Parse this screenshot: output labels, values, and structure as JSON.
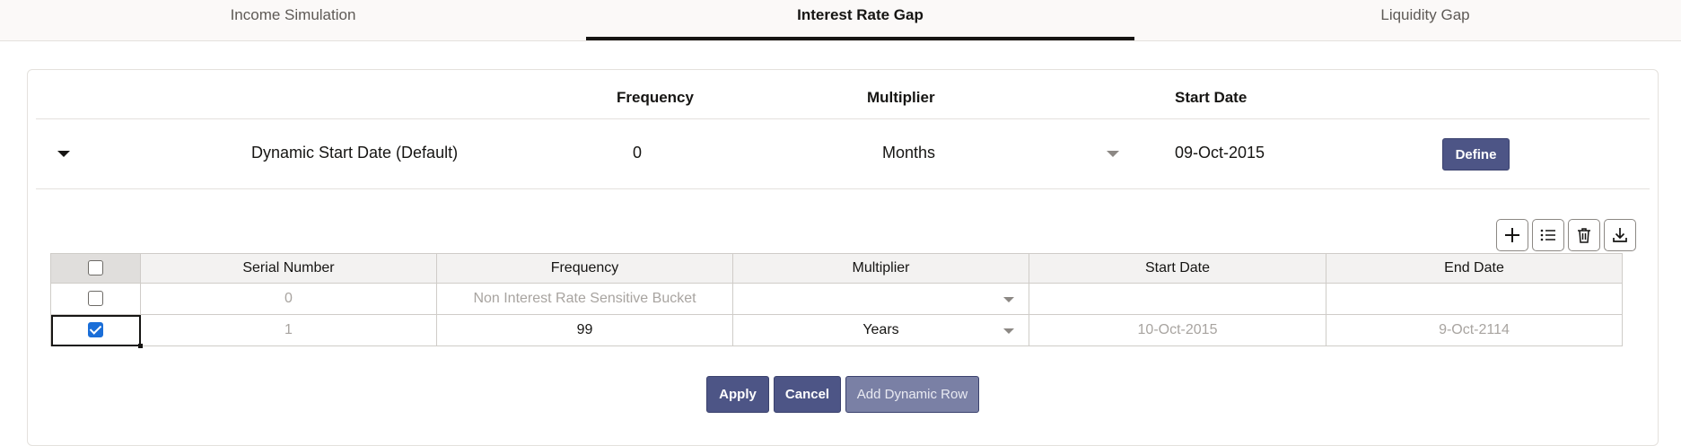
{
  "tabs": [
    {
      "label": "Income Simulation",
      "active": false
    },
    {
      "label": "Interest Rate Gap",
      "active": true
    },
    {
      "label": "Liquidity Gap",
      "active": false
    }
  ],
  "summary": {
    "headers": {
      "frequency": "Frequency",
      "multiplier": "Multiplier",
      "start_date": "Start Date"
    },
    "row": {
      "name": "Dynamic Start Date (Default)",
      "frequency": "0",
      "multiplier": "Months",
      "start_date": "09-Oct-2015",
      "define_label": "Define"
    }
  },
  "toolbar": {
    "icons": [
      "add-icon",
      "list-icon",
      "delete-icon",
      "download-icon"
    ]
  },
  "grid": {
    "columns": [
      "Serial Number",
      "Frequency",
      "Multiplier",
      "Start Date",
      "End Date"
    ],
    "rows": [
      {
        "checked": false,
        "serial": "0",
        "frequency": "Non Interest Rate Sensitive Bucket",
        "multiplier": "",
        "start_date": "",
        "end_date": ""
      },
      {
        "checked": true,
        "serial": "1",
        "frequency": "99",
        "multiplier": "Years",
        "start_date": "10-Oct-2015",
        "end_date": "9-Oct-2114"
      }
    ]
  },
  "actions": {
    "apply": "Apply",
    "cancel": "Cancel",
    "add_dynamic_row": "Add Dynamic Row"
  },
  "colors": {
    "primary_button": "#4d5586",
    "checkbox_checked": "#1a6ed8"
  }
}
